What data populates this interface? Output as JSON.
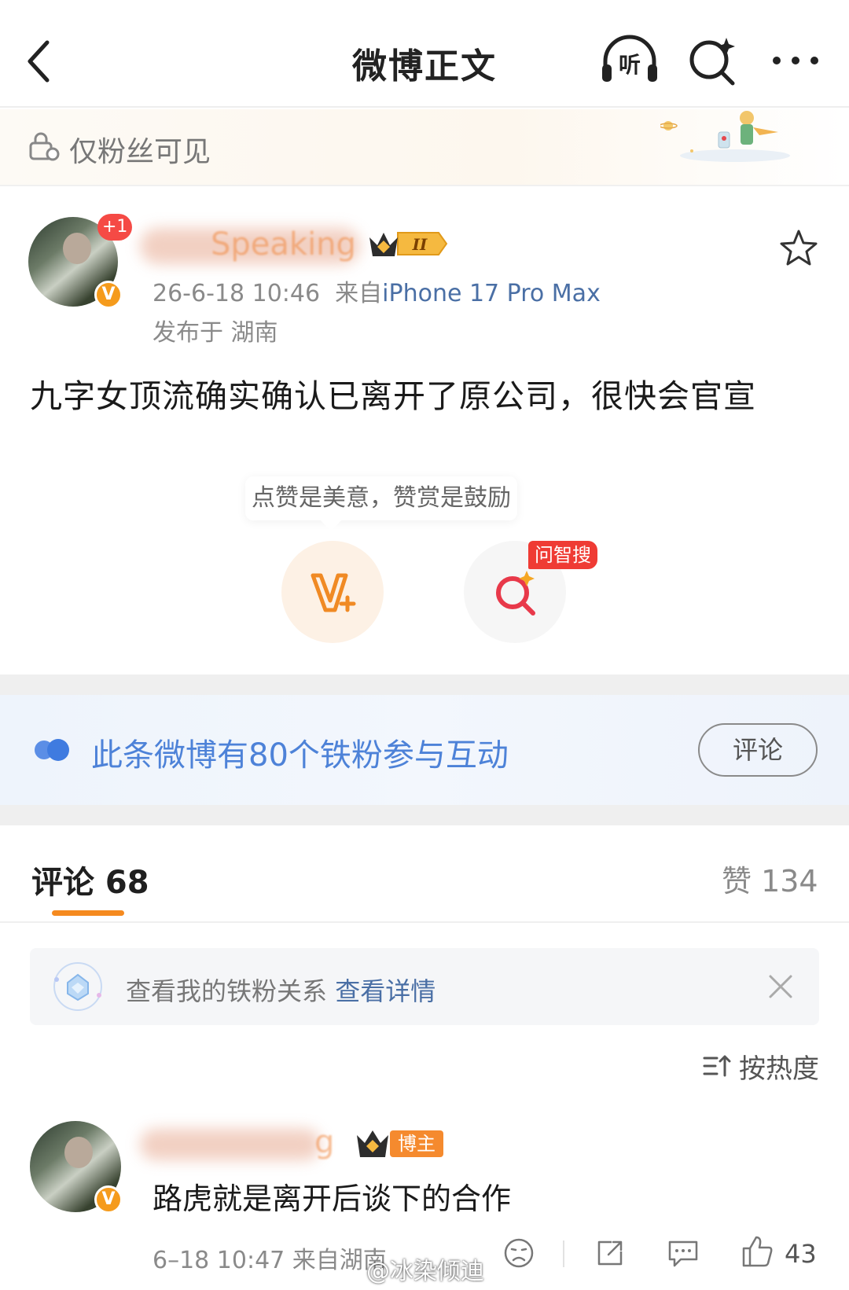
{
  "header": {
    "title": "微博正文",
    "back_icon": "chevron-left-icon",
    "listen_icon": "headphones-icon",
    "listen_label": "听",
    "search_icon": "ai-search-icon",
    "more_icon": "more-icon"
  },
  "visibility": {
    "label": "仅粉丝可见",
    "icon": "lock-user-icon"
  },
  "post": {
    "author_name": "Speaking",
    "avatar_badge": "+1",
    "verified_badge": "V",
    "level_badge": "II",
    "time": "26-6-18 10:46",
    "source_prefix": "来自",
    "device": "iPhone 17 Pro Max",
    "location": "发布于 湖南",
    "text": "九字女顶流确实确认已离开了原公司，很快会官宣"
  },
  "reward": {
    "tip": "点赞是美意，赞赏是鼓励",
    "zhisou_tag": "问智搜"
  },
  "fan_interaction": {
    "text": "此条微博有80个铁粉参与互动",
    "button": "评论"
  },
  "tabs": {
    "comments_label": "评论 68",
    "likes_label": "赞 134"
  },
  "relation": {
    "text": "查看我的铁粉关系",
    "link": "查看详情"
  },
  "sort": {
    "label": "按热度"
  },
  "comment": {
    "author_name": "g",
    "verified_badge": "V",
    "role_badge": "博主",
    "text": "路虎就是离开后谈下的合作",
    "meta": "6–18 10:47  来自湖南",
    "like_count": "43"
  },
  "watermark": "@冰染倾迪",
  "colors": {
    "accent": "#f58a1f",
    "link": "#4a6fa5",
    "fan_blue": "#4d82d8",
    "tag_red": "#ef3b34"
  }
}
